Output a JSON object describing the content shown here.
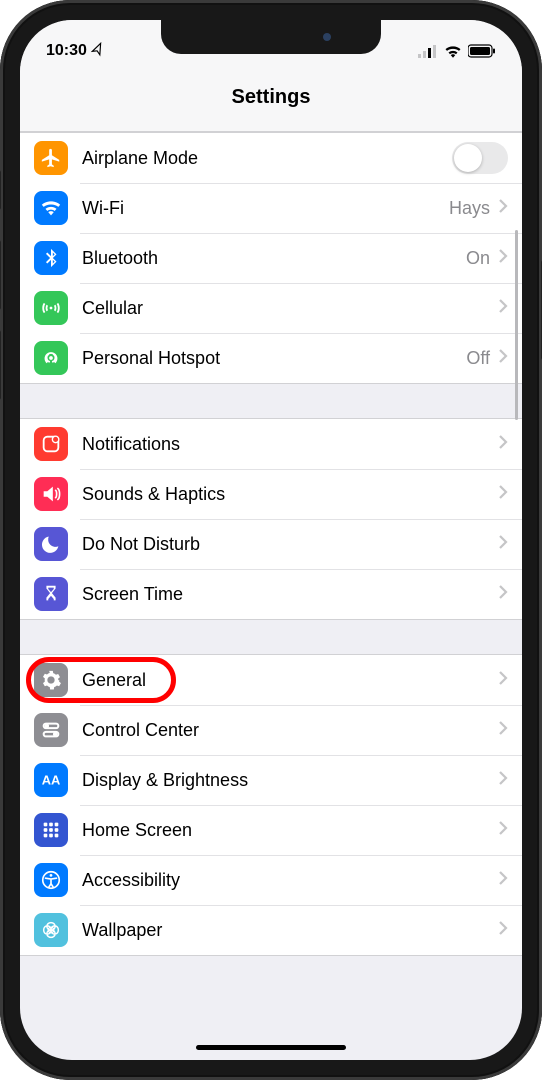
{
  "status": {
    "time": "10:30",
    "locationGlyph": "➤"
  },
  "header": {
    "title": "Settings"
  },
  "groups": [
    {
      "id": "connectivity",
      "rows": [
        {
          "id": "airplane",
          "icon": "airplane-icon",
          "iconBg": "#ff9500",
          "label": "Airplane Mode",
          "control": "toggle",
          "toggle": false
        },
        {
          "id": "wifi",
          "icon": "wifi-icon",
          "iconBg": "#007aff",
          "label": "Wi-Fi",
          "control": "value-chevron",
          "value": "Hays"
        },
        {
          "id": "bluetooth",
          "icon": "bluetooth-icon",
          "iconBg": "#007aff",
          "label": "Bluetooth",
          "control": "value-chevron",
          "value": "On"
        },
        {
          "id": "cellular",
          "icon": "cellular-icon",
          "iconBg": "#34c759",
          "label": "Cellular",
          "control": "chevron"
        },
        {
          "id": "hotspot",
          "icon": "hotspot-icon",
          "iconBg": "#34c759",
          "label": "Personal Hotspot",
          "control": "value-chevron",
          "value": "Off"
        }
      ]
    },
    {
      "id": "notifications",
      "rows": [
        {
          "id": "notifications",
          "icon": "notifications-icon",
          "iconBg": "#ff3b30",
          "label": "Notifications",
          "control": "chevron"
        },
        {
          "id": "sounds",
          "icon": "sounds-icon",
          "iconBg": "#ff2d55",
          "label": "Sounds & Haptics",
          "control": "chevron"
        },
        {
          "id": "dnd",
          "icon": "moon-icon",
          "iconBg": "#5756d5",
          "label": "Do Not Disturb",
          "control": "chevron"
        },
        {
          "id": "screentime",
          "icon": "hourglass-icon",
          "iconBg": "#5756d5",
          "label": "Screen Time",
          "control": "chevron"
        }
      ]
    },
    {
      "id": "general-group",
      "rows": [
        {
          "id": "general",
          "icon": "gear-icon",
          "iconBg": "#8e8e93",
          "label": "General",
          "control": "chevron",
          "highlight": true
        },
        {
          "id": "controlcenter",
          "icon": "switches-icon",
          "iconBg": "#8e8e93",
          "label": "Control Center",
          "control": "chevron"
        },
        {
          "id": "display",
          "icon": "display-icon",
          "iconBg": "#007aff",
          "label": "Display & Brightness",
          "control": "chevron"
        },
        {
          "id": "homescreen",
          "icon": "homescreen-icon",
          "iconBg": "#3355d1",
          "label": "Home Screen",
          "control": "chevron"
        },
        {
          "id": "accessibility",
          "icon": "accessibility-icon",
          "iconBg": "#007aff",
          "label": "Accessibility",
          "control": "chevron"
        },
        {
          "id": "wallpaper",
          "icon": "wallpaper-icon",
          "iconBg": "#51c1de",
          "label": "Wallpaper",
          "control": "chevron"
        }
      ]
    }
  ]
}
